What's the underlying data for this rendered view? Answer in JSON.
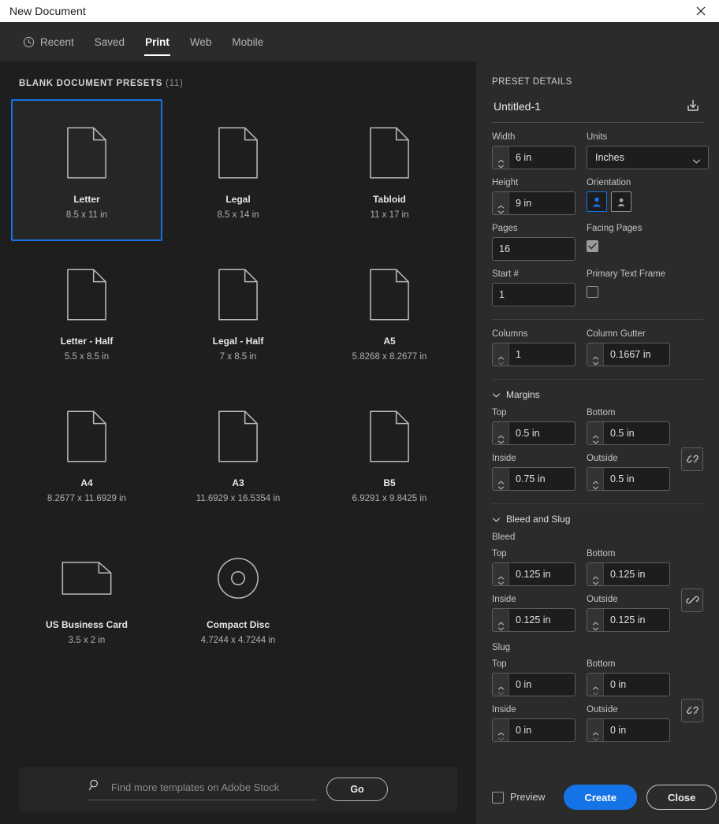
{
  "window": {
    "title": "New Document",
    "close_icon": "close-icon"
  },
  "tabs": [
    {
      "label": "Recent",
      "icon": "clock-icon",
      "active": false
    },
    {
      "label": "Saved",
      "icon": "",
      "active": false
    },
    {
      "label": "Print",
      "icon": "",
      "active": true
    },
    {
      "label": "Web",
      "icon": "",
      "active": false
    },
    {
      "label": "Mobile",
      "icon": "",
      "active": false
    }
  ],
  "presets_section": {
    "heading": "BLANK DOCUMENT PRESETS",
    "count": "(11)"
  },
  "presets": [
    {
      "name": "Letter",
      "dimensions": "8.5 x 11 in",
      "icon": "page-portrait-icon",
      "selected": true
    },
    {
      "name": "Legal",
      "dimensions": "8.5 x 14 in",
      "icon": "page-portrait-icon",
      "selected": false
    },
    {
      "name": "Tabloid",
      "dimensions": "11 x 17 in",
      "icon": "page-portrait-icon",
      "selected": false
    },
    {
      "name": "Letter - Half",
      "dimensions": "5.5 x 8.5 in",
      "icon": "page-portrait-icon",
      "selected": false
    },
    {
      "name": "Legal - Half",
      "dimensions": "7 x 8.5 in",
      "icon": "page-portrait-icon",
      "selected": false
    },
    {
      "name": "A5",
      "dimensions": "5.8268 x 8.2677 in",
      "icon": "page-portrait-icon",
      "selected": false
    },
    {
      "name": "A4",
      "dimensions": "8.2677 x 11.6929 in",
      "icon": "page-portrait-icon",
      "selected": false
    },
    {
      "name": "A3",
      "dimensions": "11.6929 x 16.5354 in",
      "icon": "page-portrait-icon",
      "selected": false
    },
    {
      "name": "B5",
      "dimensions": "6.9291 x 9.8425 in",
      "icon": "page-portrait-icon",
      "selected": false
    },
    {
      "name": "US Business Card",
      "dimensions": "3.5 x 2 in",
      "icon": "page-landscape-icon",
      "selected": false
    },
    {
      "name": "Compact Disc",
      "dimensions": "4.7244 x 4.7244 in",
      "icon": "compact-disc-icon",
      "selected": false
    }
  ],
  "stock_search": {
    "placeholder": "Find more templates on Adobe Stock",
    "value": "",
    "go_label": "Go",
    "search_icon": "search-icon"
  },
  "preset_details": {
    "heading": "PRESET DETAILS",
    "doc_name": "Untitled-1",
    "save_icon": "save-preset-icon",
    "width": {
      "label": "Width",
      "value": "6 in"
    },
    "units": {
      "label": "Units",
      "value": "Inches"
    },
    "height": {
      "label": "Height",
      "value": "9 in"
    },
    "orientation": {
      "label": "Orientation",
      "portrait_selected": true,
      "landscape_selected": false
    },
    "pages": {
      "label": "Pages",
      "value": "16"
    },
    "facing_pages": {
      "label": "Facing Pages",
      "checked": true
    },
    "start_number": {
      "label": "Start #",
      "value": "1"
    },
    "primary_text_frame": {
      "label": "Primary Text Frame",
      "checked": false
    },
    "columns": {
      "label": "Columns",
      "value": "1"
    },
    "column_gutter": {
      "label": "Column Gutter",
      "value": "0.1667 in"
    }
  },
  "margins": {
    "heading": "Margins",
    "expanded": true,
    "top": {
      "label": "Top",
      "value": "0.5 in"
    },
    "bottom": {
      "label": "Bottom",
      "value": "0.5 in"
    },
    "inside": {
      "label": "Inside",
      "value": "0.75 in"
    },
    "outside": {
      "label": "Outside",
      "value": "0.5 in"
    },
    "link_state": "unlinked"
  },
  "bleed_and_slug": {
    "heading": "Bleed and Slug",
    "expanded": true,
    "bleed": {
      "label": "Bleed",
      "top": {
        "label": "Top",
        "value": "0.125 in"
      },
      "bottom": {
        "label": "Bottom",
        "value": "0.125 in"
      },
      "inside": {
        "label": "Inside",
        "value": "0.125 in"
      },
      "outside": {
        "label": "Outside",
        "value": "0.125 in"
      },
      "link_state": "linked"
    },
    "slug": {
      "label": "Slug",
      "top": {
        "label": "Top",
        "value": "0 in"
      },
      "bottom": {
        "label": "Bottom",
        "value": "0 in"
      },
      "inside": {
        "label": "Inside",
        "value": "0 in"
      },
      "outside": {
        "label": "Outside",
        "value": "0 in"
      },
      "link_state": "unlinked"
    }
  },
  "footer": {
    "preview_label": "Preview",
    "preview_checked": false,
    "create_label": "Create",
    "close_label": "Close"
  },
  "colors": {
    "accent": "#1473e6",
    "left_panel_bg": "#1e1e1e",
    "right_panel_bg": "#2b2b2b",
    "titlebar_bg": "#ffffff"
  }
}
